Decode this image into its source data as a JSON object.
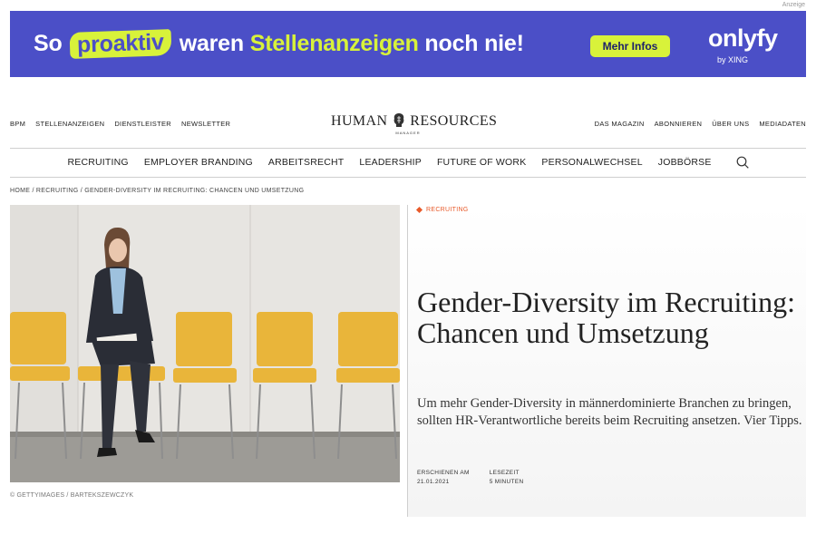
{
  "ad": {
    "label": "Anzeige",
    "headline_pre": "So",
    "headline_pill": "proaktiv",
    "headline_mid": "waren",
    "headline_hl": "Stellenanzeigen",
    "headline_post": "noch nie!",
    "button": "Mehr Infos",
    "brand": "onlyfy",
    "brand_sub": "by XING",
    "colors": {
      "background": "#4b4fc7",
      "accent": "#d8f23a"
    }
  },
  "header": {
    "left_nav": [
      "BPM",
      "STELLENANZEIGEN",
      "DIENSTLEISTER",
      "NEWSLETTER"
    ],
    "logo_left": "HUMAN",
    "logo_right": "RESOURCES",
    "logo_sub": "MANAGER",
    "right_nav": [
      "DAS MAGAZIN",
      "ABONNIEREN",
      "ÜBER UNS",
      "MEDIADATEN"
    ]
  },
  "main_nav": [
    "RECRUITING",
    "EMPLOYER BRANDING",
    "ARBEITSRECHT",
    "LEADERSHIP",
    "FUTURE OF WORK",
    "PERSONALWECHSEL",
    "JOBBÖRSE"
  ],
  "breadcrumb": "HOME / RECRUITING / GENDER-DIVERSITY IM RECRUITING: CHANCEN UND UMSETZUNG",
  "image_credit": "© GETTYIMAGES / BARTEKSZEWCZYK",
  "article": {
    "category": "RECRUITING",
    "title": "Gender-Diversity im Recruiting: Chancen und Umsetzung",
    "lede": "Um mehr Gender-Diversity in männerdominierte Branchen zu bringen, sollten HR-Verantwortliche bereits beim Recruiting ansetzen. Vier Tipps.",
    "published_label": "ERSCHIENEN AM",
    "published_date": "21.01.2021",
    "reading_label": "LESEZEIT",
    "reading_value": "5 MINUTEN",
    "accent_color": "#e85a2a"
  }
}
